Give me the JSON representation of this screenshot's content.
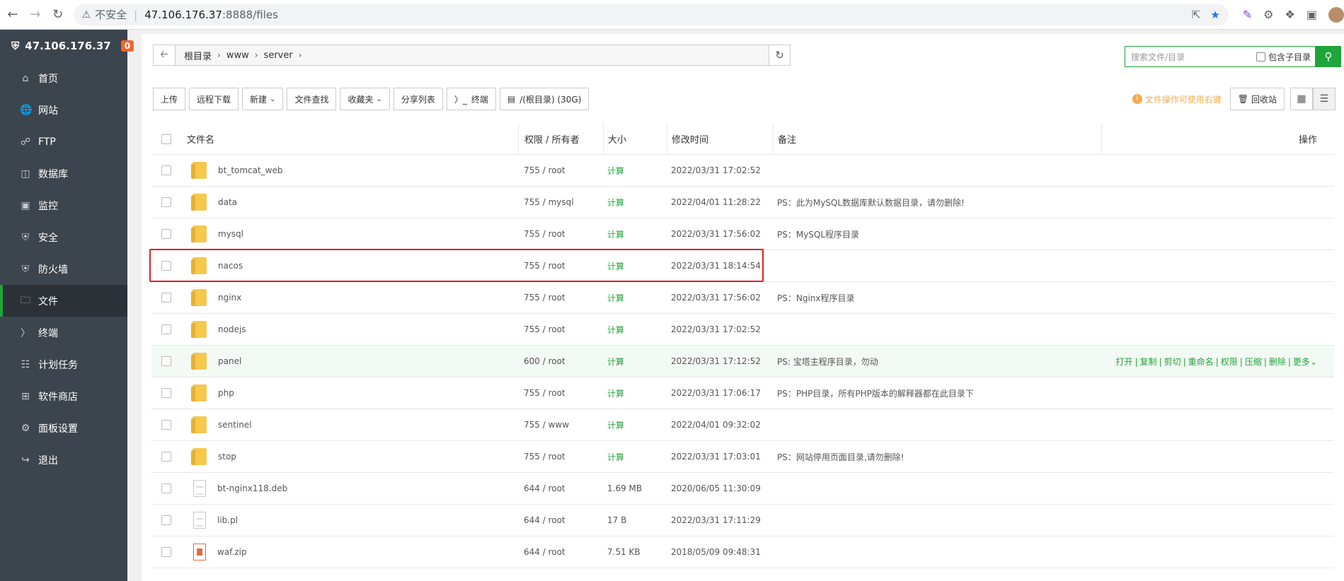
{
  "browser": {
    "insecure_label": "不安全",
    "url_host": "47.106.176.37",
    "url_path": ":8888/files"
  },
  "sidebar": {
    "host": "47.106.176.37",
    "badge": "0",
    "items": [
      {
        "label": "首页",
        "icon": "home-icon"
      },
      {
        "label": "网站",
        "icon": "globe-icon"
      },
      {
        "label": "FTP",
        "icon": "ftp-icon"
      },
      {
        "label": "数据库",
        "icon": "database-icon"
      },
      {
        "label": "监控",
        "icon": "monitor-icon"
      },
      {
        "label": "安全",
        "icon": "shield-icon"
      },
      {
        "label": "防火墙",
        "icon": "firewall-icon"
      },
      {
        "label": "文件",
        "icon": "folder-icon"
      },
      {
        "label": "终端",
        "icon": "terminal-icon"
      },
      {
        "label": "计划任务",
        "icon": "calendar-icon"
      },
      {
        "label": "软件商店",
        "icon": "apps-icon"
      },
      {
        "label": "面板设置",
        "icon": "gear-icon"
      },
      {
        "label": "退出",
        "icon": "logout-icon"
      }
    ],
    "active_index": 7,
    "active_color": "#20a53a"
  },
  "path": {
    "crumbs": [
      "根目录",
      "www",
      "server"
    ]
  },
  "search": {
    "placeholder": "搜索文件/目录",
    "include_sub_label": "包含子目录"
  },
  "toolbar": {
    "upload": "上传",
    "remote_download": "远程下载",
    "new": "新建",
    "file_search": "文件查找",
    "favorites": "收藏夹",
    "share_list": "分享列表",
    "terminal": "终端",
    "disk": "/(根目录) (30G)",
    "hint": "文件操作可使用右键",
    "recycle": "回收站"
  },
  "table": {
    "headers": {
      "name": "文件名",
      "perm": "权限 / 所有者",
      "size": "大小",
      "time": "修改时间",
      "note": "备注",
      "ops": "操作"
    },
    "rows": [
      {
        "name": "bt_tomcat_web",
        "type": "folder",
        "perm": "755 / root",
        "size": "计算",
        "time": "2022/03/31 17:02:52",
        "note": ""
      },
      {
        "name": "data",
        "type": "folder",
        "perm": "755 / mysql",
        "size": "计算",
        "time": "2022/04/01 11:28:22",
        "note": "PS：此为MySQL数据库默认数据目录，请勿删除!"
      },
      {
        "name": "mysql",
        "type": "folder",
        "perm": "755 / root",
        "size": "计算",
        "time": "2022/03/31 17:56:02",
        "note": "PS：MySQL程序目录"
      },
      {
        "name": "nacos",
        "type": "folder",
        "perm": "755 / root",
        "size": "计算",
        "time": "2022/03/31 18:14:54",
        "note": ""
      },
      {
        "name": "nginx",
        "type": "folder",
        "perm": "755 / root",
        "size": "计算",
        "time": "2022/03/31 17:56:02",
        "note": "PS：Nginx程序目录"
      },
      {
        "name": "nodejs",
        "type": "folder",
        "perm": "755 / root",
        "size": "计算",
        "time": "2022/03/31 17:02:52",
        "note": ""
      },
      {
        "name": "panel",
        "type": "folder",
        "perm": "600 / root",
        "size": "计算",
        "time": "2022/03/31 17:12:52",
        "note": "PS: 宝塔主程序目录，勿动"
      },
      {
        "name": "php",
        "type": "folder",
        "perm": "755 / root",
        "size": "计算",
        "time": "2022/03/31 17:06:17",
        "note": "PS：PHP目录，所有PHP版本的解释器都在此目录下"
      },
      {
        "name": "sentinel",
        "type": "folder",
        "perm": "755 / www",
        "size": "计算",
        "time": "2022/04/01 09:32:02",
        "note": ""
      },
      {
        "name": "stop",
        "type": "folder",
        "perm": "755 / root",
        "size": "计算",
        "time": "2022/03/31 17:03:01",
        "note": "PS：网站停用页面目录,请勿删除!"
      },
      {
        "name": "bt-nginx118.deb",
        "type": "file",
        "perm": "644 / root",
        "size": "1.69 MB",
        "time": "2020/06/05 11:30:09",
        "note": ""
      },
      {
        "name": "lib.pl",
        "type": "file",
        "perm": "644 / root",
        "size": "17 B",
        "time": "2022/03/31 17:11:29",
        "note": ""
      },
      {
        "name": "waf.zip",
        "type": "zip",
        "perm": "644 / root",
        "size": "7.51 KB",
        "time": "2018/05/09 09:48:31",
        "note": ""
      }
    ],
    "hover_row_ops": [
      "打开",
      "复制",
      "剪切",
      "重命名",
      "权限",
      "压缩",
      "删除",
      "更多"
    ]
  }
}
